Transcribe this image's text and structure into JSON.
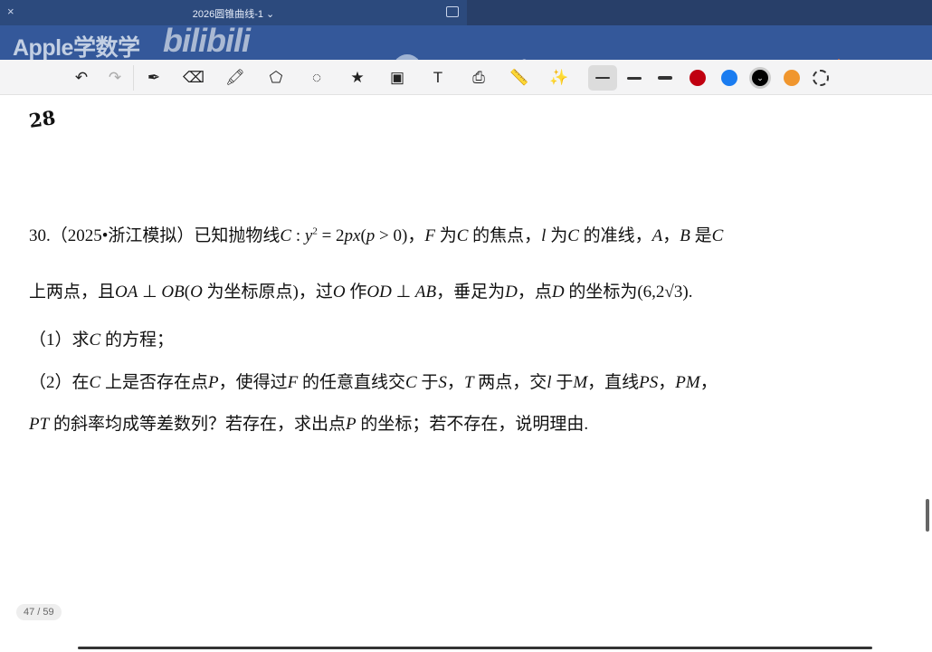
{
  "window": {
    "title": "2026圆锥曲线-1 ⌄",
    "close": "×"
  },
  "watermark": {
    "text": "Apple学数学",
    "logo": "bilibili"
  },
  "nav": {
    "back": "‹",
    "icons": [
      "grid-icon",
      "search-icon",
      "pen-mode-icon",
      "keyboard-icon",
      "microphone-icon",
      "add-page-icon",
      "bookmark-icon",
      "share-icon",
      "more-icon"
    ]
  },
  "toolbar": {
    "undo": "↶",
    "redo": "↷",
    "colors": [
      "#c00010",
      "#1a7cf0",
      "#000000",
      "#f0962e"
    ],
    "selected_color": "#000000"
  },
  "handwriting": "28",
  "problem": {
    "lines": [
      [
        {
          "t": "30.（2025•浙江模拟）已知抛物线"
        },
        {
          "t": "C",
          "i": 1
        },
        {
          "t": " : "
        },
        {
          "t": "y",
          "i": 1
        },
        {
          "t": "2",
          "s": 1
        },
        {
          "t": " = 2"
        },
        {
          "t": "px",
          "i": 1
        },
        {
          "t": "("
        },
        {
          "t": "p",
          "i": 1
        },
        {
          "t": " > 0)，"
        },
        {
          "t": "F",
          "i": 1
        },
        {
          "t": " 为"
        },
        {
          "t": "C",
          "i": 1
        },
        {
          "t": " 的焦点，"
        },
        {
          "t": "l",
          "i": 1
        },
        {
          "t": " 为"
        },
        {
          "t": "C",
          "i": 1
        },
        {
          "t": " 的准线，"
        },
        {
          "t": "A",
          "i": 1
        },
        {
          "t": "，"
        },
        {
          "t": "B",
          "i": 1
        },
        {
          "t": " 是"
        },
        {
          "t": "C",
          "i": 1
        }
      ],
      [
        {
          "t": "上两点，且"
        },
        {
          "t": "OA",
          "i": 1
        },
        {
          "t": " ⊥ "
        },
        {
          "t": "OB",
          "i": 1
        },
        {
          "t": "("
        },
        {
          "t": "O",
          "i": 1
        },
        {
          "t": " 为坐标原点)，过"
        },
        {
          "t": "O",
          "i": 1
        },
        {
          "t": " 作"
        },
        {
          "t": "OD",
          "i": 1
        },
        {
          "t": " ⊥ "
        },
        {
          "t": "AB",
          "i": 1
        },
        {
          "t": "，垂足为"
        },
        {
          "t": "D",
          "i": 1
        },
        {
          "t": "，点"
        },
        {
          "t": "D",
          "i": 1
        },
        {
          "t": " 的坐标为(6,2√3)."
        }
      ],
      [
        {
          "t": "（1）求"
        },
        {
          "t": "C",
          "i": 1
        },
        {
          "t": " 的方程；"
        }
      ],
      [
        {
          "t": "（2）在"
        },
        {
          "t": "C",
          "i": 1
        },
        {
          "t": " 上是否存在点"
        },
        {
          "t": "P",
          "i": 1
        },
        {
          "t": "，使得过"
        },
        {
          "t": "F",
          "i": 1
        },
        {
          "t": " 的任意直线交"
        },
        {
          "t": "C",
          "i": 1
        },
        {
          "t": " 于"
        },
        {
          "t": "S",
          "i": 1
        },
        {
          "t": "，"
        },
        {
          "t": "T",
          "i": 1
        },
        {
          "t": " 两点，交"
        },
        {
          "t": "l",
          "i": 1
        },
        {
          "t": " 于"
        },
        {
          "t": "M",
          "i": 1
        },
        {
          "t": "，直线"
        },
        {
          "t": "PS",
          "i": 1
        },
        {
          "t": "，"
        },
        {
          "t": "PM",
          "i": 1
        },
        {
          "t": "，"
        }
      ],
      [
        {
          "t": "PT",
          "i": 1
        },
        {
          "t": " 的斜率均成等差数列？若存在，求出点"
        },
        {
          "t": "P",
          "i": 1
        },
        {
          "t": " 的坐标；若不存在，说明理由."
        }
      ]
    ]
  },
  "pager": "47 / 59"
}
